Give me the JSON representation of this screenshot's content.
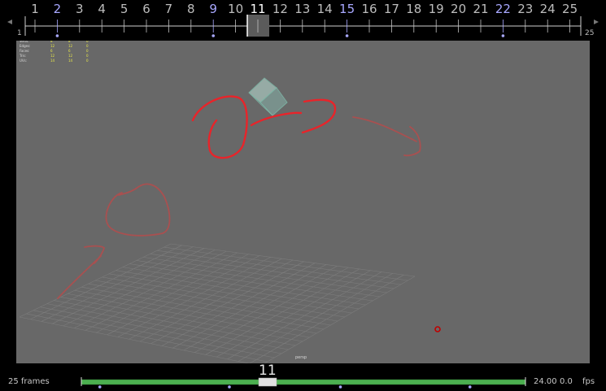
{
  "timeline": {
    "frames": [
      "1",
      "2",
      "3",
      "4",
      "5",
      "6",
      "7",
      "8",
      "9",
      "10",
      "11",
      "12",
      "13",
      "14",
      "15",
      "16",
      "17",
      "18",
      "19",
      "20",
      "21",
      "22",
      "23",
      "24",
      "25"
    ],
    "keyframes": [
      "2",
      "9",
      "15",
      "22"
    ],
    "current_frame": "11",
    "range_start": "1",
    "range_end": "25",
    "key_color": "#a8a8ff",
    "current_color": "#ffffff",
    "label_color": "#bdbdbd"
  },
  "hud": {
    "rows": [
      {
        "label": "Verts:",
        "values": [
          "8",
          "8",
          "0"
        ]
      },
      {
        "label": "Edges:",
        "values": [
          "12",
          "12",
          "0"
        ]
      },
      {
        "label": "Faces:",
        "values": [
          "6",
          "6",
          "0"
        ]
      },
      {
        "label": "Tris:",
        "values": [
          "12",
          "12",
          "0"
        ]
      },
      {
        "label": "UVs:",
        "values": [
          "14",
          "14",
          "0"
        ]
      }
    ],
    "value_color": "#e8e84a"
  },
  "viewport": {
    "background": "#686868",
    "camera_label": "persp"
  },
  "bottom": {
    "frame_count": "25 frames",
    "current_frame": "11",
    "fps_value": "24.00",
    "offset_value": "0.0",
    "fps_unit": "fps",
    "slider_color": "#4caf50"
  }
}
